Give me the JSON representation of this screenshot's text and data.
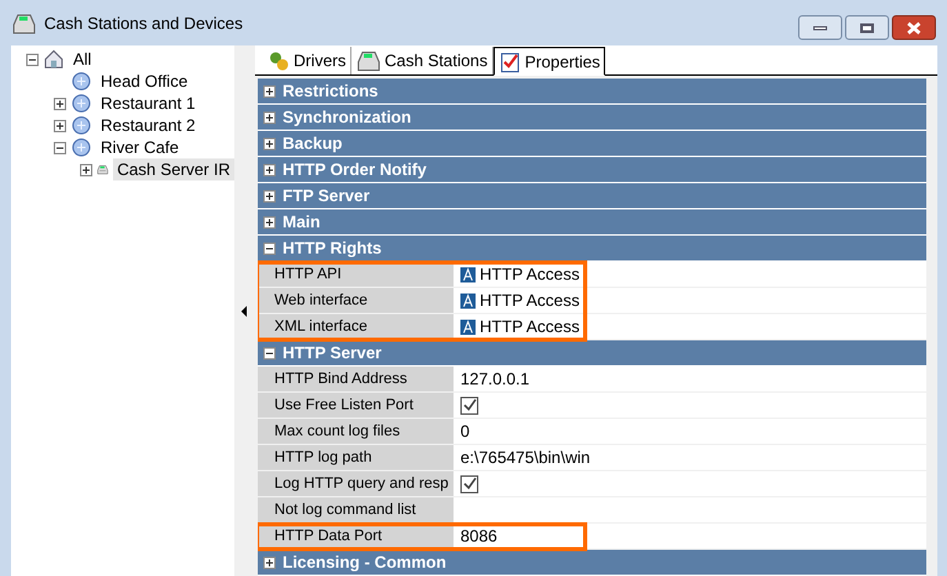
{
  "window": {
    "title": "Cash Stations and Devices"
  },
  "tree": [
    {
      "label": "All",
      "kind": "root",
      "expanded": true,
      "selected": false,
      "children": [
        {
          "label": "Head Office",
          "kind": "location",
          "selected": false
        },
        {
          "label": "Restaurant 1",
          "kind": "location",
          "expanded": false,
          "selected": false
        },
        {
          "label": "Restaurant 2",
          "kind": "location",
          "expanded": false,
          "selected": false
        },
        {
          "label": "River Cafe",
          "kind": "location",
          "expanded": true,
          "selected": false,
          "children": [
            {
              "label": "Cash Server IR",
              "kind": "server",
              "expanded": false,
              "selected": true
            }
          ]
        }
      ]
    }
  ],
  "tabs": [
    {
      "label": "Drivers",
      "kind": "drivers",
      "selected": false
    },
    {
      "label": "Cash Stations",
      "kind": "stations",
      "selected": false
    },
    {
      "label": "Properties",
      "kind": "properties",
      "selected": true
    }
  ],
  "sections": [
    {
      "title": "Restrictions",
      "expanded": false
    },
    {
      "title": "Synchronization",
      "expanded": false
    },
    {
      "title": "Backup",
      "expanded": false
    },
    {
      "title": "HTTP Order Notify",
      "expanded": false
    },
    {
      "title": "FTP Server",
      "expanded": false
    },
    {
      "title": "Main",
      "expanded": false
    },
    {
      "title": "HTTP Rights",
      "expanded": true,
      "properties": [
        {
          "name": "HTTP API",
          "kind": "access",
          "value": "HTTP Access",
          "highlighted": true
        },
        {
          "name": "Web interface",
          "kind": "access",
          "value": "HTTP Access",
          "highlighted": true
        },
        {
          "name": "XML interface",
          "kind": "access",
          "value": "HTTP Access",
          "highlighted": true
        }
      ]
    },
    {
      "title": "HTTP Server",
      "expanded": true,
      "properties": [
        {
          "name": "HTTP Bind Address",
          "kind": "text",
          "value": "127.0.0.1",
          "highlighted": false
        },
        {
          "name": "Use Free Listen Port",
          "kind": "check",
          "checked": true,
          "highlighted": false
        },
        {
          "name": "Max count log files",
          "kind": "text",
          "value": "0",
          "highlighted": false
        },
        {
          "name": "HTTP log path",
          "kind": "text",
          "value": "e:\\765475\\bin\\win",
          "highlighted": false
        },
        {
          "name": "Log HTTP query and resp",
          "kind": "check",
          "checked": true,
          "highlighted": false
        },
        {
          "name": "Not log command list",
          "kind": "empty",
          "highlighted": false
        },
        {
          "name": "HTTP Data Port",
          "kind": "text",
          "value": "8086",
          "highlighted": true
        }
      ]
    },
    {
      "title": "Licensing - Common",
      "expanded": false
    }
  ]
}
